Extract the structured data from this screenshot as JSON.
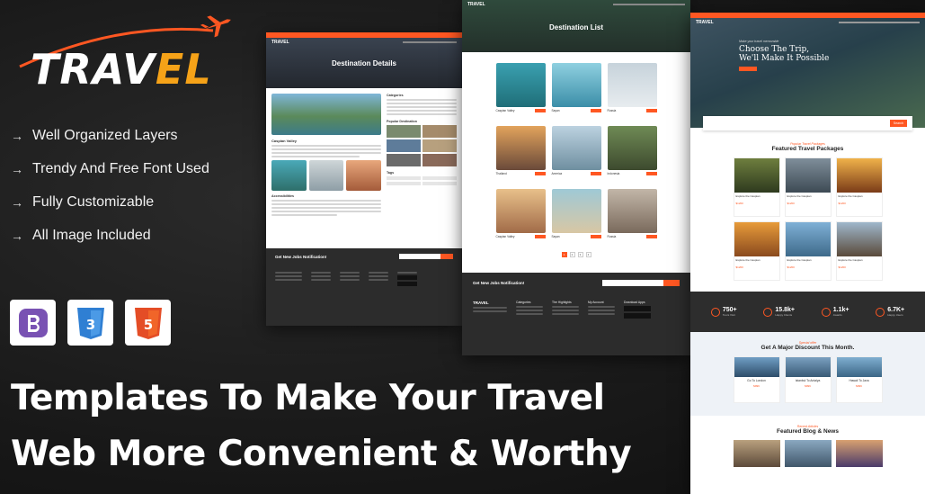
{
  "brand": {
    "logo_text": "TRAVEL",
    "logo_accent_part": "EL",
    "accent_color": "#ff5722",
    "logo_yellow": "#f5a218",
    "logo_icon": "airplane-icon"
  },
  "features": [
    {
      "arrow": "→",
      "label": "Well Organized Layers"
    },
    {
      "arrow": "→",
      "label": "Trendy And Free Font Used"
    },
    {
      "arrow": "→",
      "label": "Fully Customizable"
    },
    {
      "arrow": "→",
      "label": "All Image Included"
    }
  ],
  "tech_icons": [
    "bootstrap-icon",
    "css3-icon",
    "html5-icon"
  ],
  "headline": {
    "line1": "Templates To Make Your Travel",
    "line2": "Web More Convenient & Worthy"
  },
  "screen_details": {
    "hero_title": "Destination Details",
    "place_title": "Caspian Valley",
    "section_amenities": "Accessibilities",
    "sidebar_categories": "Categories",
    "sidebar_popular": "Popular Destination",
    "sidebar_tags": "Tags",
    "newsletter": "Get New Jobs Notification!"
  },
  "screen_list": {
    "hero_title": "Destination List",
    "places": [
      {
        "name": "Caspian Valley"
      },
      {
        "name": "Sayan"
      },
      {
        "name": "Russia"
      },
      {
        "name": "Thailand"
      },
      {
        "name": "America"
      },
      {
        "name": "Indonesia"
      },
      {
        "name": "Caspian Valley"
      },
      {
        "name": "Sayan"
      },
      {
        "name": "Russia"
      }
    ],
    "pages": [
      "1",
      "2",
      "3",
      "4"
    ],
    "active_page": "1",
    "newsletter": "Get New Jobs Notification!",
    "footer_cols": [
      "Categories",
      "The Highlights",
      "My Account",
      "Download Apps"
    ]
  },
  "screen_home": {
    "hero_tagline": "Make your travel memorable",
    "hero_line1": "Choose The Trip,",
    "hero_line2": "We'll Make It Possible",
    "search_button": "Search",
    "packages_sub": "Popular Travel Packages",
    "packages_title": "Featured Travel Packages",
    "packages": [
      {
        "title": "Explore the Caspian",
        "price": "$1200"
      },
      {
        "title": "Explore the Caspian",
        "price": "$1200"
      },
      {
        "title": "Explore the Caspian",
        "price": "$1200"
      },
      {
        "title": "Explore the Caspian",
        "price": "$1200"
      },
      {
        "title": "Explore the Caspian",
        "price": "$1200"
      },
      {
        "title": "Explore the Caspian",
        "price": "$1200"
      }
    ],
    "stats": [
      {
        "num": "750+",
        "label": "Tours Visit"
      },
      {
        "num": "15.8k+",
        "label": "Happy Clients"
      },
      {
        "num": "1.1k+",
        "label": "Awards"
      },
      {
        "num": "6.7K+",
        "label": "Happy Users"
      }
    ],
    "discount_sub": "Special offer",
    "discount_title": "Get A Major Discount This Month.",
    "discounts": [
      {
        "title": "Go To London",
        "price": "$999"
      },
      {
        "title": "Istanbul To Antalya",
        "price": "$999"
      },
      {
        "title": "Hawaii To Java",
        "price": "$999"
      }
    ],
    "blog_sub": "Recent Articles",
    "blog_title": "Featured Blog & News"
  }
}
